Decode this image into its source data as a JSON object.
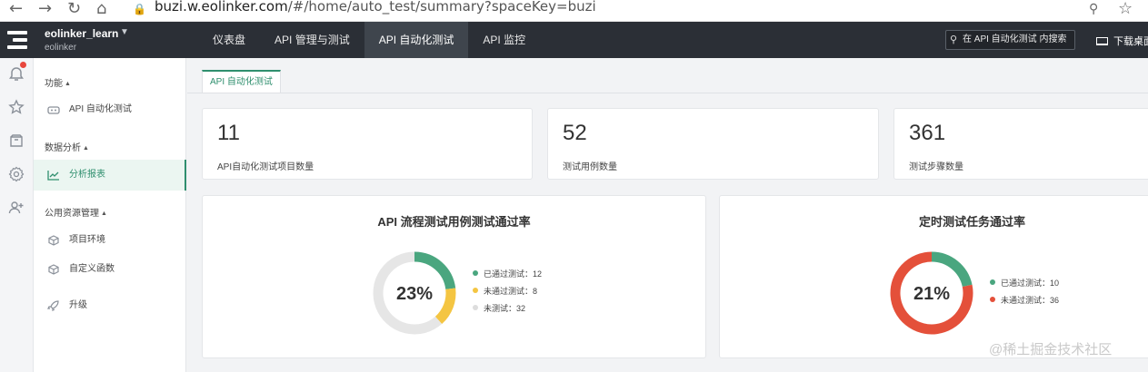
{
  "browser": {
    "url_host": "buzi.w.eolinker.com",
    "url_path": "/#/home/auto_test/summary?spaceKey=buzi"
  },
  "topbar": {
    "workspace_name": "eolinker_learn",
    "workspace_sub": "eolinker",
    "tabs": [
      {
        "label": "仪表盘",
        "active": false
      },
      {
        "label": "API 管理与测试",
        "active": false
      },
      {
        "label": "API 自动化测试",
        "active": true
      },
      {
        "label": "API 监控",
        "active": false
      }
    ],
    "search_placeholder": "在 API 自动化测试 内搜索",
    "download_label": "下载桌面"
  },
  "rail_icons": [
    "bell-icon",
    "star-icon",
    "bag-icon",
    "gear-icon",
    "add-user-icon"
  ],
  "sidebar": {
    "groups": [
      {
        "label": "功能",
        "items": [
          {
            "label": "API 自动化测试",
            "icon": "robot-icon",
            "active": false
          }
        ]
      },
      {
        "label": "数据分析",
        "items": [
          {
            "label": "分析报表",
            "icon": "chart-line-icon",
            "active": true
          }
        ]
      },
      {
        "label": "公用资源管理",
        "items": [
          {
            "label": "项目环境",
            "icon": "cube-icon",
            "active": false
          },
          {
            "label": "自定义函数",
            "icon": "cube-icon",
            "active": false
          }
        ]
      }
    ],
    "upgrade_label": "升级"
  },
  "content": {
    "tab_label": "API 自动化测试",
    "stats": [
      {
        "value": "11",
        "label": "API自动化测试项目数量"
      },
      {
        "value": "52",
        "label": "测试用例数量"
      },
      {
        "value": "361",
        "label": "测试步骤数量"
      }
    ]
  },
  "colors": {
    "passed": "#4aa67f",
    "failed_yellow": "#f4c542",
    "untested": "#e6e6e6",
    "failed_red": "#e4503a",
    "accent": "#2f8f6e"
  },
  "chart_data": [
    {
      "type": "pie",
      "title": "API 流程测试用例测试通过率",
      "center_label": "23%",
      "slices": [
        {
          "name": "已通过测试",
          "value": 12,
          "legend": "已通过测试：12",
          "color": "#4aa67f"
        },
        {
          "name": "未通过测试",
          "value": 8,
          "legend": "未通过测试：8",
          "color": "#f4c542"
        },
        {
          "name": "未测试",
          "value": 32,
          "legend": "未测试：32",
          "color": "#e6e6e6"
        }
      ]
    },
    {
      "type": "pie",
      "title": "定时测试任务通过率",
      "center_label": "21%",
      "slices": [
        {
          "name": "已通过测试",
          "value": 10,
          "legend": "已通过测试：10",
          "color": "#4aa67f"
        },
        {
          "name": "未通过测试",
          "value": 36,
          "legend": "未通过测试：36",
          "color": "#e4503a"
        }
      ]
    }
  ],
  "watermark": "@稀土掘金技术社区"
}
